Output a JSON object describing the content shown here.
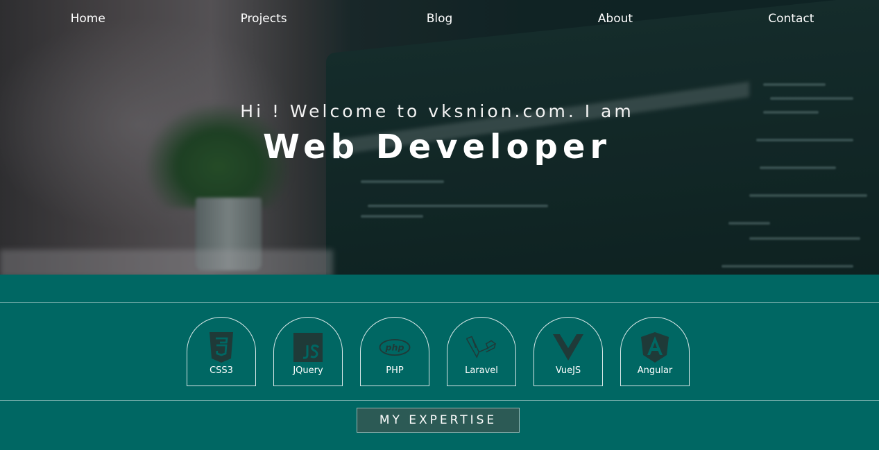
{
  "nav": {
    "items": [
      "Home",
      "Projects",
      "Blog",
      "About",
      "Contact"
    ]
  },
  "hero": {
    "greeting": "Hi ! Welcome to vksnion.com. I am",
    "headline": "Web Developer"
  },
  "skills": [
    {
      "label": "CSS3",
      "icon": "css3-icon"
    },
    {
      "label": "JQuery",
      "icon": "js-icon"
    },
    {
      "label": "PHP",
      "icon": "php-icon"
    },
    {
      "label": "Laravel",
      "icon": "laravel-icon"
    },
    {
      "label": "VueJS",
      "icon": "vuejs-icon"
    },
    {
      "label": "Angular",
      "icon": "angular-icon"
    }
  ],
  "expertise_button": "MY EXPERTISE",
  "colors": {
    "background": "#006763",
    "button": "#2c5a55",
    "icon": "#1f3a38"
  }
}
